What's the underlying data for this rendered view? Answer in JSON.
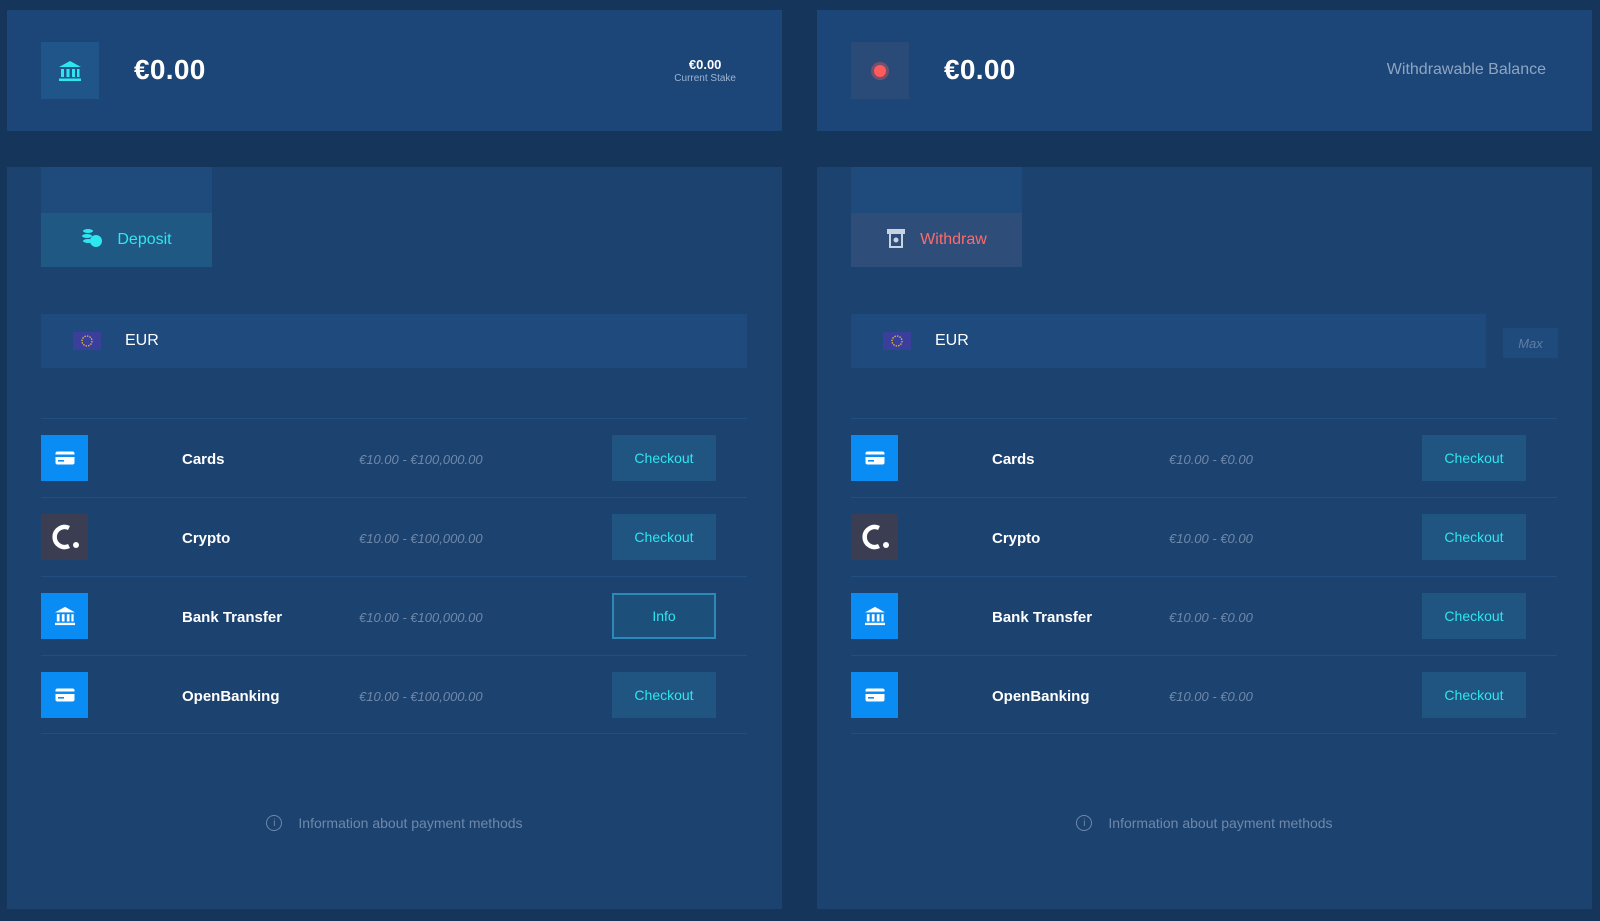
{
  "colors": {
    "background": "#16355a",
    "card": "#1c4678",
    "panel": "#1c426f",
    "accent_cyan": "#2ee6ef",
    "accent_red": "#ff6b6b",
    "method_blue": "#0a8cf5"
  },
  "deposit_balance": {
    "icon": "bank-icon",
    "amount": "€0.00",
    "stake_value": "€0.00",
    "stake_label": "Current Stake"
  },
  "withdraw_balance": {
    "icon": "record-dot-icon",
    "amount": "€0.00",
    "label": "Withdrawable Balance"
  },
  "deposit": {
    "tab_label": "Deposit",
    "tab_icon": "coins-icon",
    "currency": "EUR",
    "methods": [
      {
        "name": "Cards",
        "icon": "card-icon",
        "range": "€10.00 - €100,000.00",
        "button": "Checkout"
      },
      {
        "name": "Crypto",
        "icon": "crypto-c-icon",
        "range": "€10.00 - €100,000.00",
        "button": "Checkout"
      },
      {
        "name": "Bank Transfer",
        "icon": "bank-icon",
        "range": "€10.00 - €100,000.00",
        "button": "Info"
      },
      {
        "name": "OpenBanking",
        "icon": "card-icon",
        "range": "€10.00 - €100,000.00",
        "button": "Checkout"
      }
    ],
    "info_text": "Information about payment methods"
  },
  "withdraw": {
    "tab_label": "Withdraw",
    "tab_icon": "atm-icon",
    "currency": "EUR",
    "max_label": "Max",
    "methods": [
      {
        "name": "Cards",
        "icon": "card-icon",
        "range": "€10.00 - €0.00",
        "button": "Checkout"
      },
      {
        "name": "Crypto",
        "icon": "crypto-c-icon",
        "range": "€10.00 - €0.00",
        "button": "Checkout"
      },
      {
        "name": "Bank Transfer",
        "icon": "bank-icon",
        "range": "€10.00 - €0.00",
        "button": "Checkout"
      },
      {
        "name": "OpenBanking",
        "icon": "card-icon",
        "range": "€10.00 - €0.00",
        "button": "Checkout"
      }
    ],
    "info_text": "Information about payment methods"
  }
}
